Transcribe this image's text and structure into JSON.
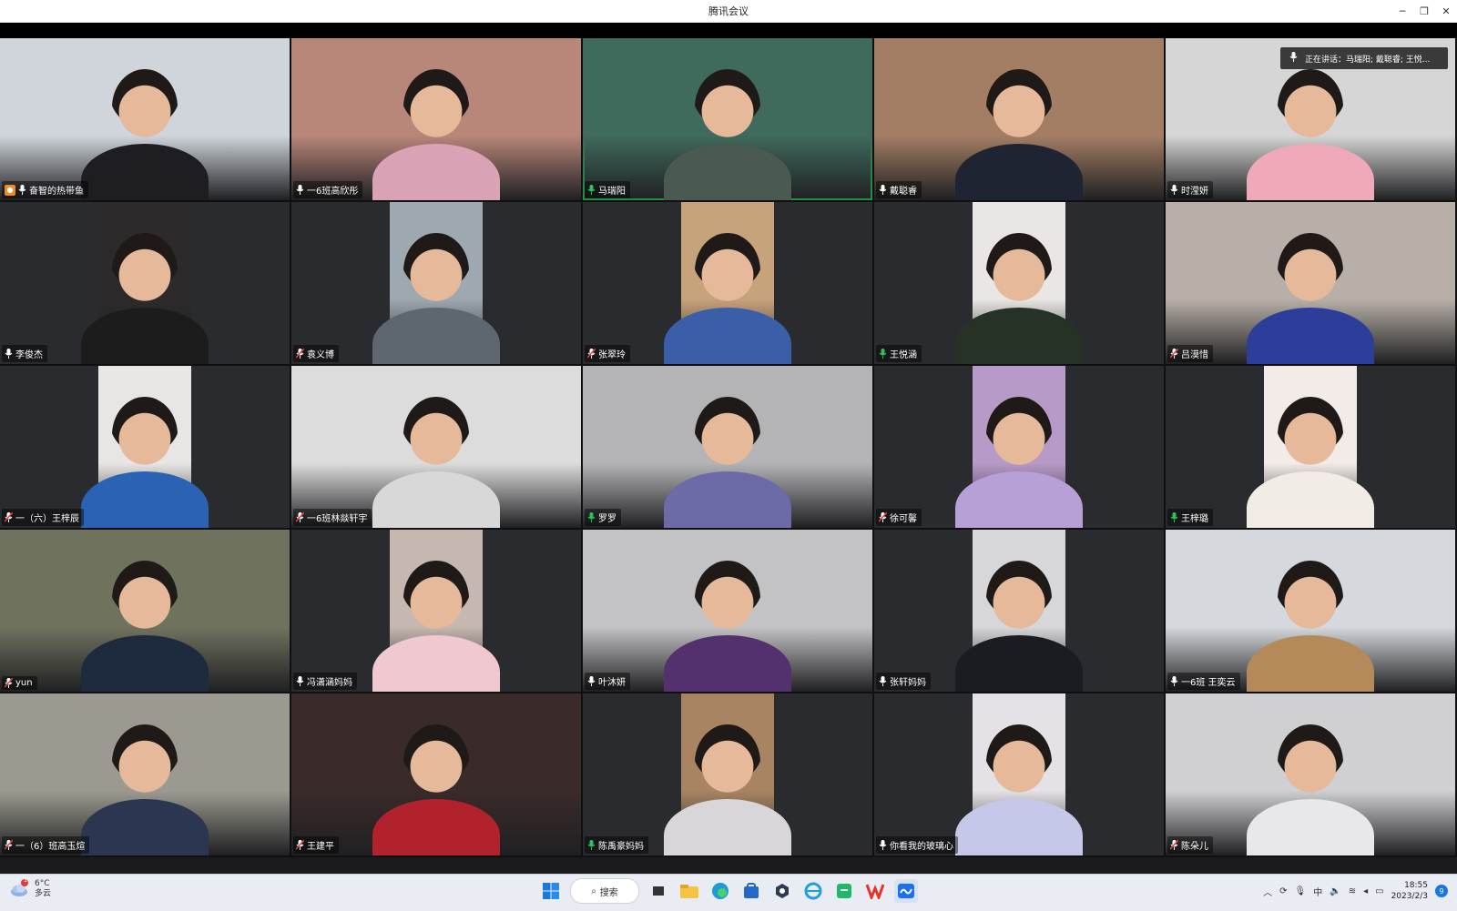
{
  "window": {
    "title": "腾讯会议"
  },
  "speaking": {
    "text": "正在讲话：马瑞阳; 戴聪睿; 王悦..."
  },
  "participants": [
    {
      "name": "奋智的热带鱼",
      "mic": "on",
      "host": true,
      "layout": "full",
      "bg": "#cfd5db",
      "shirt": "#1e1e22"
    },
    {
      "name": "一6班高欣彤",
      "mic": "on",
      "layout": "full",
      "bg": "#b9867a",
      "shirt": "#d9a3b5"
    },
    {
      "name": "马瑞阳",
      "mic": "speaking",
      "active": true,
      "layout": "full",
      "bg": "#3f6a5c",
      "shirt": "#4a5a50"
    },
    {
      "name": "戴聪睿",
      "mic": "on",
      "layout": "full",
      "bg": "#a47e64",
      "shirt": "#1f2433"
    },
    {
      "name": "时滢妍",
      "mic": "on",
      "layout": "full",
      "bg": "#d6d6d6",
      "shirt": "#f0a9b8"
    },
    {
      "name": "李俊杰",
      "mic": "on",
      "layout": "narrow",
      "bg": "#2c2a2b",
      "shirt": "#1c1c1c"
    },
    {
      "name": "袁义博",
      "mic": "muted",
      "layout": "narrow",
      "bg": "#9ea8b0",
      "shirt": "#5e6670"
    },
    {
      "name": "张翠玲",
      "mic": "muted",
      "layout": "narrow",
      "bg": "#c7a37b",
      "shirt": "#3b5ea8"
    },
    {
      "name": "王悦涵",
      "mic": "speaking",
      "layout": "narrow",
      "bg": "#e9e6e3",
      "shirt": "#263226"
    },
    {
      "name": "吕漠惜",
      "mic": "muted",
      "layout": "full",
      "bg": "#b8b0a8",
      "shirt": "#2c3e9a"
    },
    {
      "name": "一（六）王梓辰",
      "mic": "muted",
      "layout": "narrow",
      "bg": "#e8e6e4",
      "shirt": "#2a63b4"
    },
    {
      "name": "一6班林燚轩宇",
      "mic": "muted",
      "layout": "full",
      "bg": "#dcdcdc",
      "shirt": "#d8d8d8"
    },
    {
      "name": "罗罗",
      "mic": "speaking",
      "layout": "full",
      "bg": "#b4b3b6",
      "shirt": "#6d6aa8"
    },
    {
      "name": "徐可馨",
      "mic": "muted",
      "layout": "narrow",
      "bg": "#b89ac8",
      "shirt": "#b7a0d8"
    },
    {
      "name": "王梓璐",
      "mic": "speaking",
      "layout": "narrow",
      "bg": "#f3ebe8",
      "shirt": "#f1ede6"
    },
    {
      "name": "yun",
      "mic": "muted",
      "layout": "full",
      "bg": "#6f735e",
      "shirt": "#1e2a3e"
    },
    {
      "name": "冯潇涵妈妈",
      "mic": "on",
      "layout": "narrow",
      "bg": "#c6b7b0",
      "shirt": "#f0c8d0"
    },
    {
      "name": "叶沐妍",
      "mic": "on",
      "layout": "full",
      "bg": "#c3c2c4",
      "shirt": "#55306e"
    },
    {
      "name": "张轩妈妈",
      "mic": "on",
      "layout": "narrow",
      "bg": "#d7d7d9",
      "shirt": "#1b1b22"
    },
    {
      "name": "一6班 王奕云",
      "mic": "on",
      "layout": "full",
      "bg": "#d5d8dc",
      "shirt": "#b58a5a"
    },
    {
      "name": "一（6）班高玉煊",
      "mic": "muted",
      "layout": "full",
      "bg": "#9c9a90",
      "shirt": "#2c3650"
    },
    {
      "name": "王建平",
      "mic": "muted",
      "layout": "full",
      "bg": "#3a2a2a",
      "shirt": "#b2222c"
    },
    {
      "name": "陈禹豪妈妈",
      "mic": "speaking",
      "layout": "narrow",
      "bg": "#a98463",
      "shirt": "#d8d6d8"
    },
    {
      "name": "你看我的玻璃心",
      "mic": "on",
      "layout": "narrow",
      "bg": "#e4e2e6",
      "shirt": "#c6c8ea"
    },
    {
      "name": "陈朵儿",
      "mic": "muted",
      "layout": "full",
      "bg": "#d0cfd2",
      "shirt": "#e8e8ea"
    }
  ],
  "taskbar": {
    "weather_temp": "6°C",
    "weather_desc": "多云",
    "weather_badge": "1",
    "search_label": "搜索",
    "ime": "中",
    "time": "18:55",
    "date": "2023/2/3",
    "notifications": "9"
  },
  "colors": {
    "accent_green": "#2fc05a",
    "host_orange": "#f08a24",
    "muted_red": "#e04040"
  }
}
